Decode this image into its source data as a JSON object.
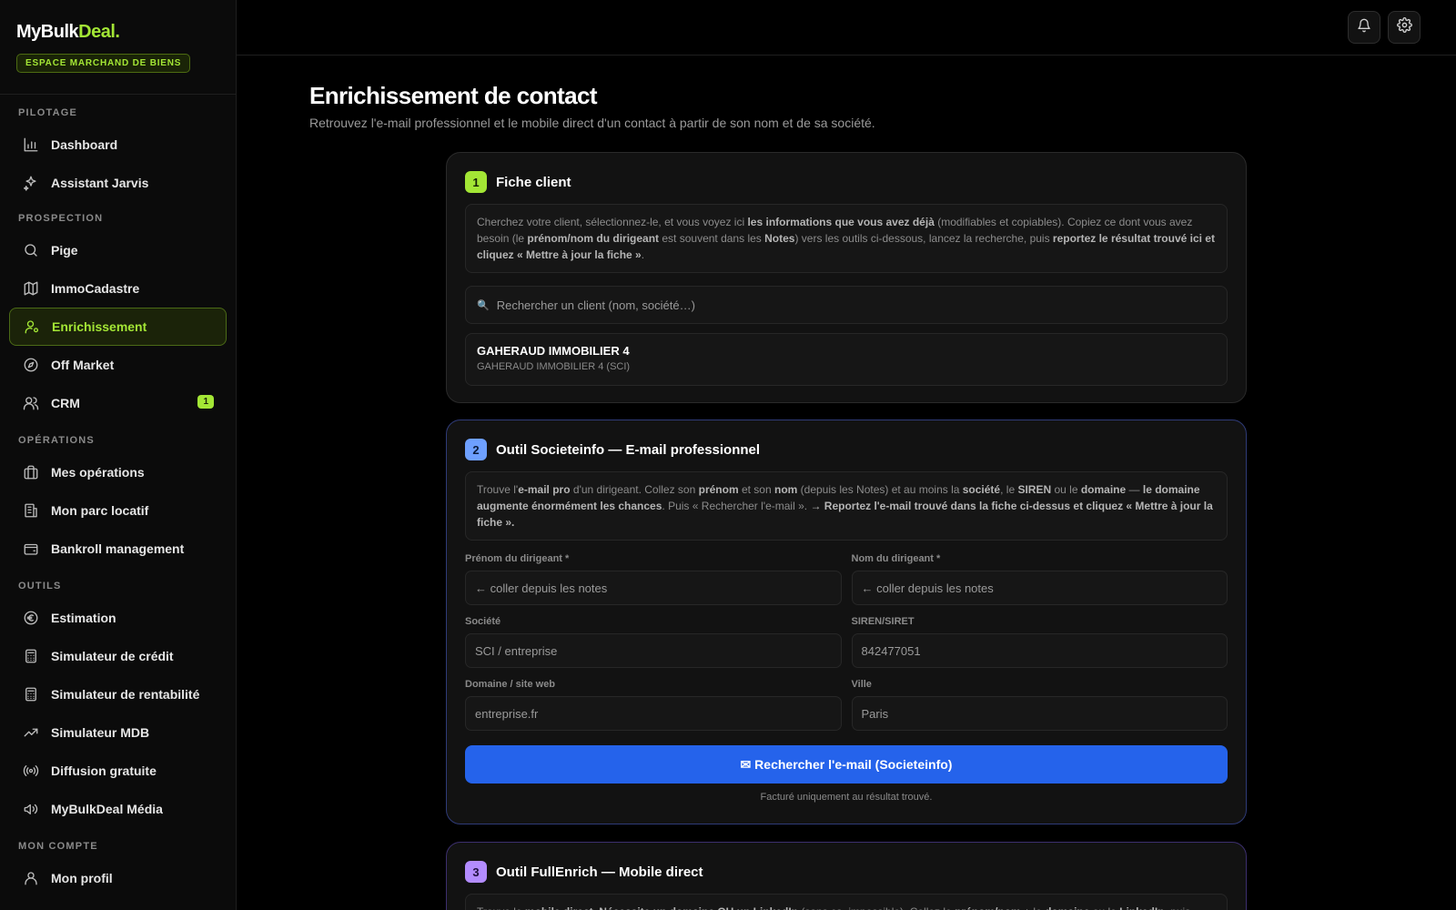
{
  "brand": {
    "logo_main": "MyBulk",
    "logo_accent": "Deal",
    "logo_dot": ".",
    "badge": "ESPACE MARCHAND DE BIENS"
  },
  "sidebar": {
    "sections": [
      {
        "title": "PILOTAGE",
        "items": [
          {
            "label": "Dashboard",
            "icon": "bar-chart-icon"
          },
          {
            "label": "Assistant Jarvis",
            "icon": "sparkles-icon"
          }
        ]
      },
      {
        "title": "PROSPECTION",
        "items": [
          {
            "label": "Pige",
            "icon": "search-icon"
          },
          {
            "label": "ImmoCadastre",
            "icon": "map-icon"
          },
          {
            "label": "Enrichissement",
            "icon": "user-gear-icon",
            "active": true
          },
          {
            "label": "Off Market",
            "icon": "compass-icon"
          },
          {
            "label": "CRM",
            "icon": "users-icon",
            "count": "1"
          }
        ]
      },
      {
        "title": "OPÉRATIONS",
        "items": [
          {
            "label": "Mes opérations",
            "icon": "briefcase-icon"
          },
          {
            "label": "Mon parc locatif",
            "icon": "building-icon"
          },
          {
            "label": "Bankroll management",
            "icon": "wallet-icon"
          }
        ]
      },
      {
        "title": "OUTILS",
        "items": [
          {
            "label": "Estimation",
            "icon": "euro-icon"
          },
          {
            "label": "Simulateur de crédit",
            "icon": "calculator-icon"
          },
          {
            "label": "Simulateur de rentabilité",
            "icon": "calculator-icon"
          },
          {
            "label": "Simulateur MDB",
            "icon": "trending-up-icon"
          },
          {
            "label": "Diffusion gratuite",
            "icon": "broadcast-icon"
          },
          {
            "label": "MyBulkDeal Média",
            "icon": "megaphone-icon"
          }
        ]
      },
      {
        "title": "MON COMPTE",
        "items": [
          {
            "label": "Mon profil",
            "icon": "user-icon"
          }
        ]
      }
    ]
  },
  "page": {
    "title": "Enrichissement de contact",
    "subtitle": "Retrouvez l'e-mail professionnel et le mobile direct d'un contact à partir de son nom et de sa société."
  },
  "card1": {
    "step": "1",
    "title": "Fiche client",
    "info": [
      {
        "t": "Cherchez votre client, sélectionnez-le, et vous voyez ici "
      },
      {
        "t": "les informations que vous avez déjà",
        "b": true
      },
      {
        "t": " (modifiables et copiables). Copiez ce dont vous avez besoin (le "
      },
      {
        "t": "prénom/nom du dirigeant",
        "b": true
      },
      {
        "t": " est souvent dans les "
      },
      {
        "t": "Notes",
        "b": true
      },
      {
        "t": ") vers les outils ci-dessous, lancez la recherche, puis "
      },
      {
        "t": "reportez le résultat trouvé ici et cliquez « Mettre à jour la fiche »",
        "b": true
      },
      {
        "t": "."
      }
    ],
    "search_placeholder": "Rechercher un client (nom, société…)",
    "client": {
      "name": "GAHERAUD IMMOBILIER 4",
      "sub": "GAHERAUD IMMOBILIER 4 (SCI)"
    }
  },
  "card2": {
    "step": "2",
    "title": "Outil Societeinfo — E-mail professionnel",
    "info": [
      {
        "t": "Trouve l'"
      },
      {
        "t": "e-mail pro",
        "b": true
      },
      {
        "t": " d'un dirigeant. Collez son "
      },
      {
        "t": "prénom",
        "b": true
      },
      {
        "t": " et son "
      },
      {
        "t": "nom",
        "b": true
      },
      {
        "t": " (depuis les Notes) et au moins la "
      },
      {
        "t": "société",
        "b": true
      },
      {
        "t": ", le "
      },
      {
        "t": "SIREN",
        "b": true
      },
      {
        "t": " ou le "
      },
      {
        "t": "domaine",
        "b": true
      },
      {
        "t": " — "
      },
      {
        "t": "le domaine augmente énormément les chances",
        "b": true
      },
      {
        "t": ". Puis « Rechercher l'e-mail ». "
      },
      {
        "t": "→ Reportez l'e-mail trouvé dans la fiche ci-dessus et cliquez « Mettre à jour la fiche ».",
        "b": true
      }
    ],
    "fields": [
      {
        "label": "Prénom du dirigeant *",
        "value": "← coller depuis les notes",
        "name": "first-name-input"
      },
      {
        "label": "Nom du dirigeant *",
        "value": "← coller depuis les notes",
        "name": "last-name-input"
      },
      {
        "label": "Société",
        "value": "SCI / entreprise",
        "name": "company-input"
      },
      {
        "label": "SIREN/SIRET",
        "value": "842477051",
        "name": "siren-input"
      },
      {
        "label": "Domaine / site web",
        "value": "entreprise.fr",
        "name": "domain-input"
      },
      {
        "label": "Ville",
        "value": "Paris",
        "name": "city-input"
      }
    ],
    "button": "✉ Rechercher l'e-mail (Societeinfo)",
    "footnote": "Facturé uniquement au résultat trouvé."
  },
  "card3": {
    "step": "3",
    "title": "Outil FullEnrich — Mobile direct",
    "info": [
      {
        "t": "Trouve le "
      },
      {
        "t": "mobile direct",
        "b": true
      },
      {
        "t": ". "
      },
      {
        "t": "Nécessite un domaine OU un LinkedIn",
        "b": true
      },
      {
        "t": " (sans ça, impossible). Collez le "
      },
      {
        "t": "prénom/nom",
        "b": true
      },
      {
        "t": " + le "
      },
      {
        "t": "domaine",
        "b": true
      },
      {
        "t": " ou le "
      },
      {
        "t": "LinkedIn",
        "b": true
      },
      {
        "t": ", puis"
      }
    ]
  }
}
